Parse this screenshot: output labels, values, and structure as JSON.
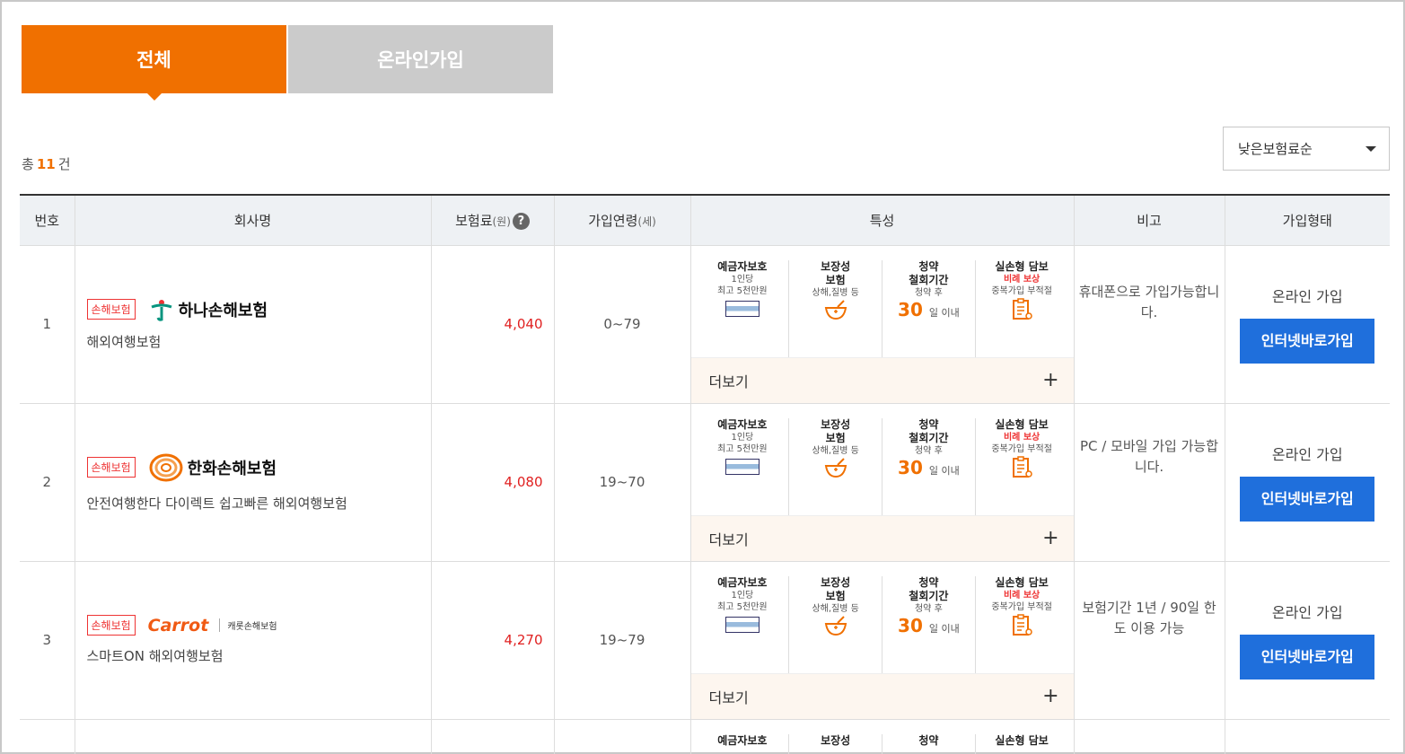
{
  "tabs": [
    {
      "label": "전체"
    },
    {
      "label": "온라인가입"
    }
  ],
  "count": {
    "prefix": "총",
    "value": "11",
    "suffix": "건"
  },
  "sort": {
    "selected": "낮은보험료순"
  },
  "table": {
    "headers": {
      "no": "번호",
      "company": "회사명",
      "premium": "보험료",
      "premium_unit": "(원)",
      "age": "가입연령",
      "age_unit": "(세)",
      "feature": "특성",
      "note": "비고",
      "join": "가입형태"
    }
  },
  "features": {
    "f1_title": "예금자보호",
    "f1_l1": "1인당",
    "f1_l2": "최고 5천만원",
    "f2_title1": "보장성",
    "f2_title2": "보험",
    "f2_sub": "상해,질병 등",
    "f3_title1": "청약",
    "f3_title2": "철회기간",
    "f3_sub": "청약 후",
    "f3_num": "30",
    "f3_unit": "일 이내",
    "f4_title": "실손형 담보",
    "f4_red": "비례 보상",
    "f4_sub": "중복가입 부적절",
    "more": "더보기"
  },
  "rows": [
    {
      "no": "1",
      "badge": "손해보험",
      "company": "하나손해보험",
      "product": "해외여행보험",
      "premium": "4,040",
      "age": "0~79",
      "note": "휴대폰으로 가입가능합니다.",
      "join_type": "온라인 가입",
      "button": "인터넷바로가입"
    },
    {
      "no": "2",
      "badge": "손해보험",
      "company": "한화손해보험",
      "product": "안전여행한다 다이렉트 쉽고빠른 해외여행보험",
      "premium": "4,080",
      "age": "19~70",
      "note": "PC / 모바일 가입 가능합니다.",
      "join_type": "온라인 가입",
      "button": "인터넷바로가입"
    },
    {
      "no": "3",
      "badge": "손해보험",
      "company": "Carrot",
      "company_sub": "캐롯손해보험",
      "product": "스마트ON 해외여행보험",
      "premium": "4,270",
      "age": "19~79",
      "note": "보험기간 1년 / 90일 한도 이용 가능",
      "join_type": "온라인 가입",
      "button": "인터넷바로가입"
    }
  ]
}
